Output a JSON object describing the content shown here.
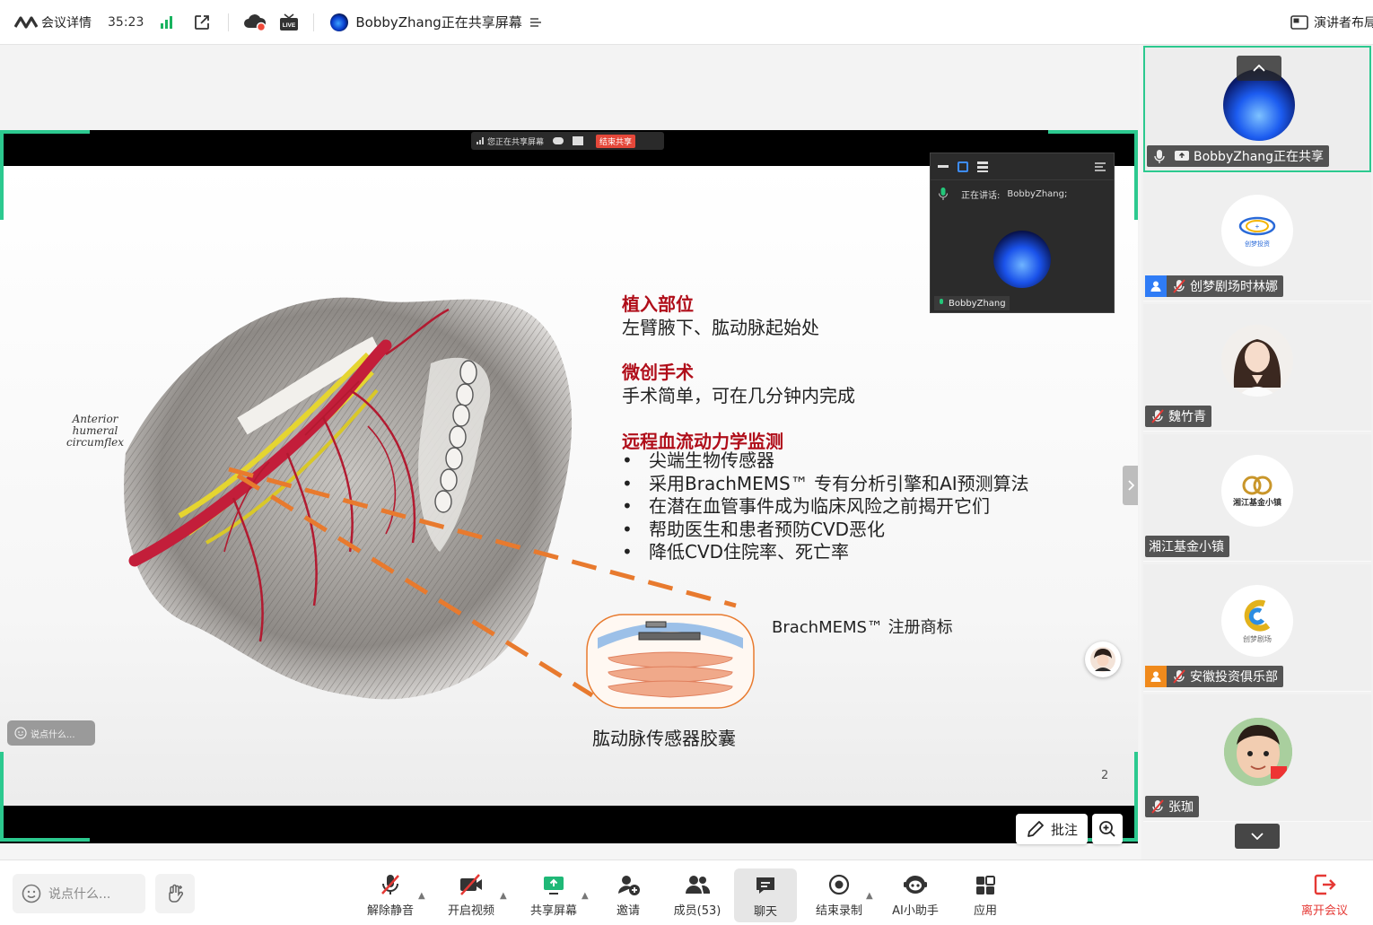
{
  "topbar": {
    "meeting_details": "会议详情",
    "timer": "35:23",
    "sharing_status": "BobbyZhang正在共享屏幕",
    "speaker_layout": "演讲者布局"
  },
  "share_overlay": {
    "sharing_label": "您正在共享屏幕",
    "stop_share": "结束共享",
    "speaking_label": "正在讲话:",
    "speaking_name": "BobbyZhang;",
    "self_name": "BobbyZhang"
  },
  "slide": {
    "anatomy_label_1": "Anterior",
    "anatomy_label_2": "humeral",
    "anatomy_label_3": "circumflex",
    "section1_title": "植入部位",
    "section1_text": "左臂腋下、肱动脉起始处",
    "section2_title": "微创手术",
    "section2_text": "手术简单，可在几分钟内完成",
    "section3_title": "远程血流动力学监测",
    "bullets": [
      "尖端生物传感器",
      "采用BrachMEMS™ 专有分析引擎和AI预测算法",
      "在潜在血管事件成为临床风险之前揭开它们",
      "帮助医生和患者预防CVD恶化",
      "降低CVD住院率、死亡率"
    ],
    "trademark": "BrachMEMS™  注册商标",
    "capsule_caption": "肱动脉传感器胶囊",
    "page_number": "2"
  },
  "stage": {
    "chat_placeholder": "说点什么...",
    "annotate": "批注"
  },
  "participants": [
    {
      "name": "BobbyZhang正在共享"
    },
    {
      "name": "创梦剧场时林娜",
      "logo_text": "创梦投资"
    },
    {
      "name": "魏竹青"
    },
    {
      "name": "湘江基金小镇",
      "logo_text": "湘江基金小镇"
    },
    {
      "name": "安徽投资俱乐部",
      "logo_text": "创梦剧场"
    },
    {
      "name": "张珈"
    }
  ],
  "bottombar": {
    "chat_input_placeholder": "说点什么...",
    "unmute": "解除静音",
    "start_video": "开启视频",
    "share_screen": "共享屏幕",
    "invite": "邀请",
    "members": "成员(53)",
    "chat": "聊天",
    "stop_recording": "结束录制",
    "ai_assistant": "AI小助手",
    "apps": "应用",
    "leave": "离开会议"
  },
  "colors": {
    "accent_green": "#2cc98f",
    "slide_red": "#b00e1a",
    "orange_dash": "#e87a2e",
    "leave_red": "#e53935"
  }
}
